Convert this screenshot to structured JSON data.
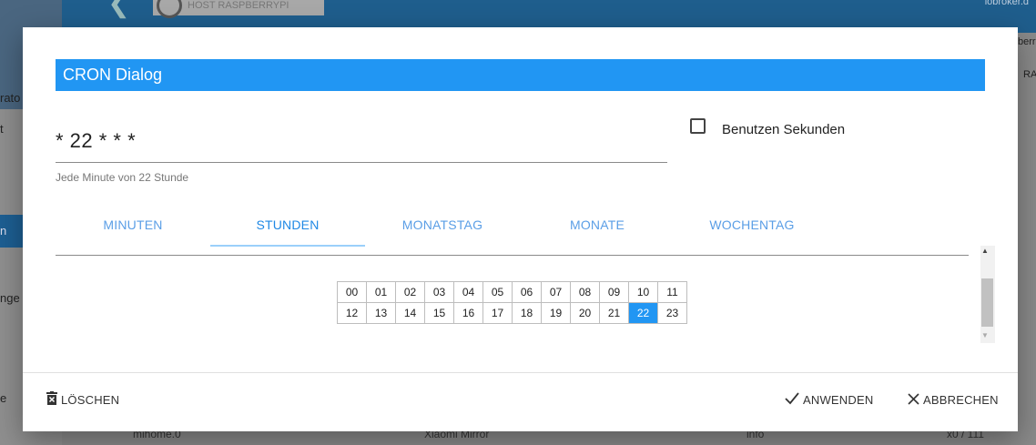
{
  "background": {
    "host_button": "HOST RASPBERRYPI",
    "brand": "iobroker.d",
    "sidebar_fragments": [
      "rato",
      "t",
      "n",
      "nge",
      "e"
    ],
    "right_fragments": [
      "berr",
      "RA"
    ],
    "row": {
      "name": "mihome.0",
      "title": "Xiaomi Mirror",
      "level": "info",
      "version": "x0 / 111"
    }
  },
  "dialog": {
    "title": "CRON Dialog",
    "cron_value": "* 22 * * *",
    "cron_description": "Jede Minute von 22 Stunde",
    "use_seconds": {
      "label": "Benutzen Sekunden",
      "checked": false
    },
    "tabs": [
      {
        "label": "MINUTEN",
        "active": false
      },
      {
        "label": "STUNDEN",
        "active": true
      },
      {
        "label": "MONATSTAG",
        "active": false
      },
      {
        "label": "MONATE",
        "active": false
      },
      {
        "label": "WOCHENTAG",
        "active": false
      }
    ],
    "hours": {
      "rows": [
        [
          "00",
          "01",
          "02",
          "03",
          "04",
          "05",
          "06",
          "07",
          "08",
          "09",
          "10",
          "11"
        ],
        [
          "12",
          "13",
          "14",
          "15",
          "16",
          "17",
          "18",
          "19",
          "20",
          "21",
          "22",
          "23"
        ]
      ],
      "selected": [
        "22"
      ]
    },
    "buttons": {
      "clear": "LÖSCHEN",
      "apply": "ANWENDEN",
      "cancel": "ABBRECHEN"
    }
  },
  "colors": {
    "accent": "#2196f3",
    "tab_text": "#5a9ee6"
  }
}
